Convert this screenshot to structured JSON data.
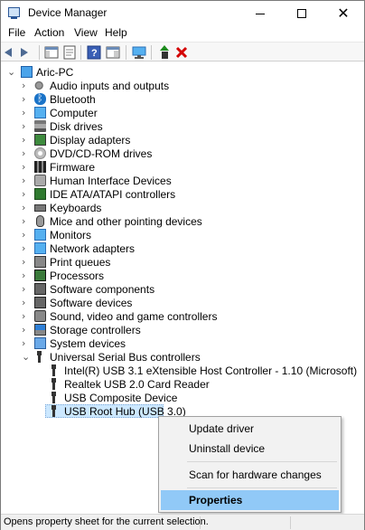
{
  "window": {
    "title": "Device Manager"
  },
  "menu": [
    "File",
    "Action",
    "View",
    "Help"
  ],
  "toolbar": {
    "buttons": [
      "back-icon",
      "forward-icon",
      "show-hide-console-tree-icon",
      "properties-icon",
      "help-icon",
      "action-pane-icon",
      "scan-hardware-icon",
      "update-driver-icon",
      "uninstall-device-icon"
    ],
    "uninstall_color": "#d40000",
    "update_color": "#1e8c1e"
  },
  "tree": {
    "root": "Aric-PC",
    "categories": [
      "Audio inputs and outputs",
      "Bluetooth",
      "Computer",
      "Disk drives",
      "Display adapters",
      "DVD/CD-ROM drives",
      "Firmware",
      "Human Interface Devices",
      "IDE ATA/ATAPI controllers",
      "Keyboards",
      "Mice and other pointing devices",
      "Monitors",
      "Network adapters",
      "Print queues",
      "Processors",
      "Software components",
      "Software devices",
      "Sound, video and game controllers",
      "Storage controllers",
      "System devices",
      "Universal Serial Bus controllers"
    ],
    "usb_children": [
      "Intel(R) USB 3.1 eXtensible Host Controller - 1.10 (Microsoft)",
      "Realtek USB 2.0 Card Reader",
      "USB Composite Device",
      "USB Root Hub (USB 3.0)"
    ],
    "selected": "USB Root Hub (USB 3.0)",
    "selection_color": "#cce8ff"
  },
  "context_menu": {
    "items": [
      "Update driver",
      "Uninstall device",
      "Scan for hardware changes",
      "Properties"
    ],
    "highlighted": "Properties",
    "highlight_color": "#91c9f7"
  },
  "status": {
    "text": "Opens property sheet for the current selection."
  }
}
